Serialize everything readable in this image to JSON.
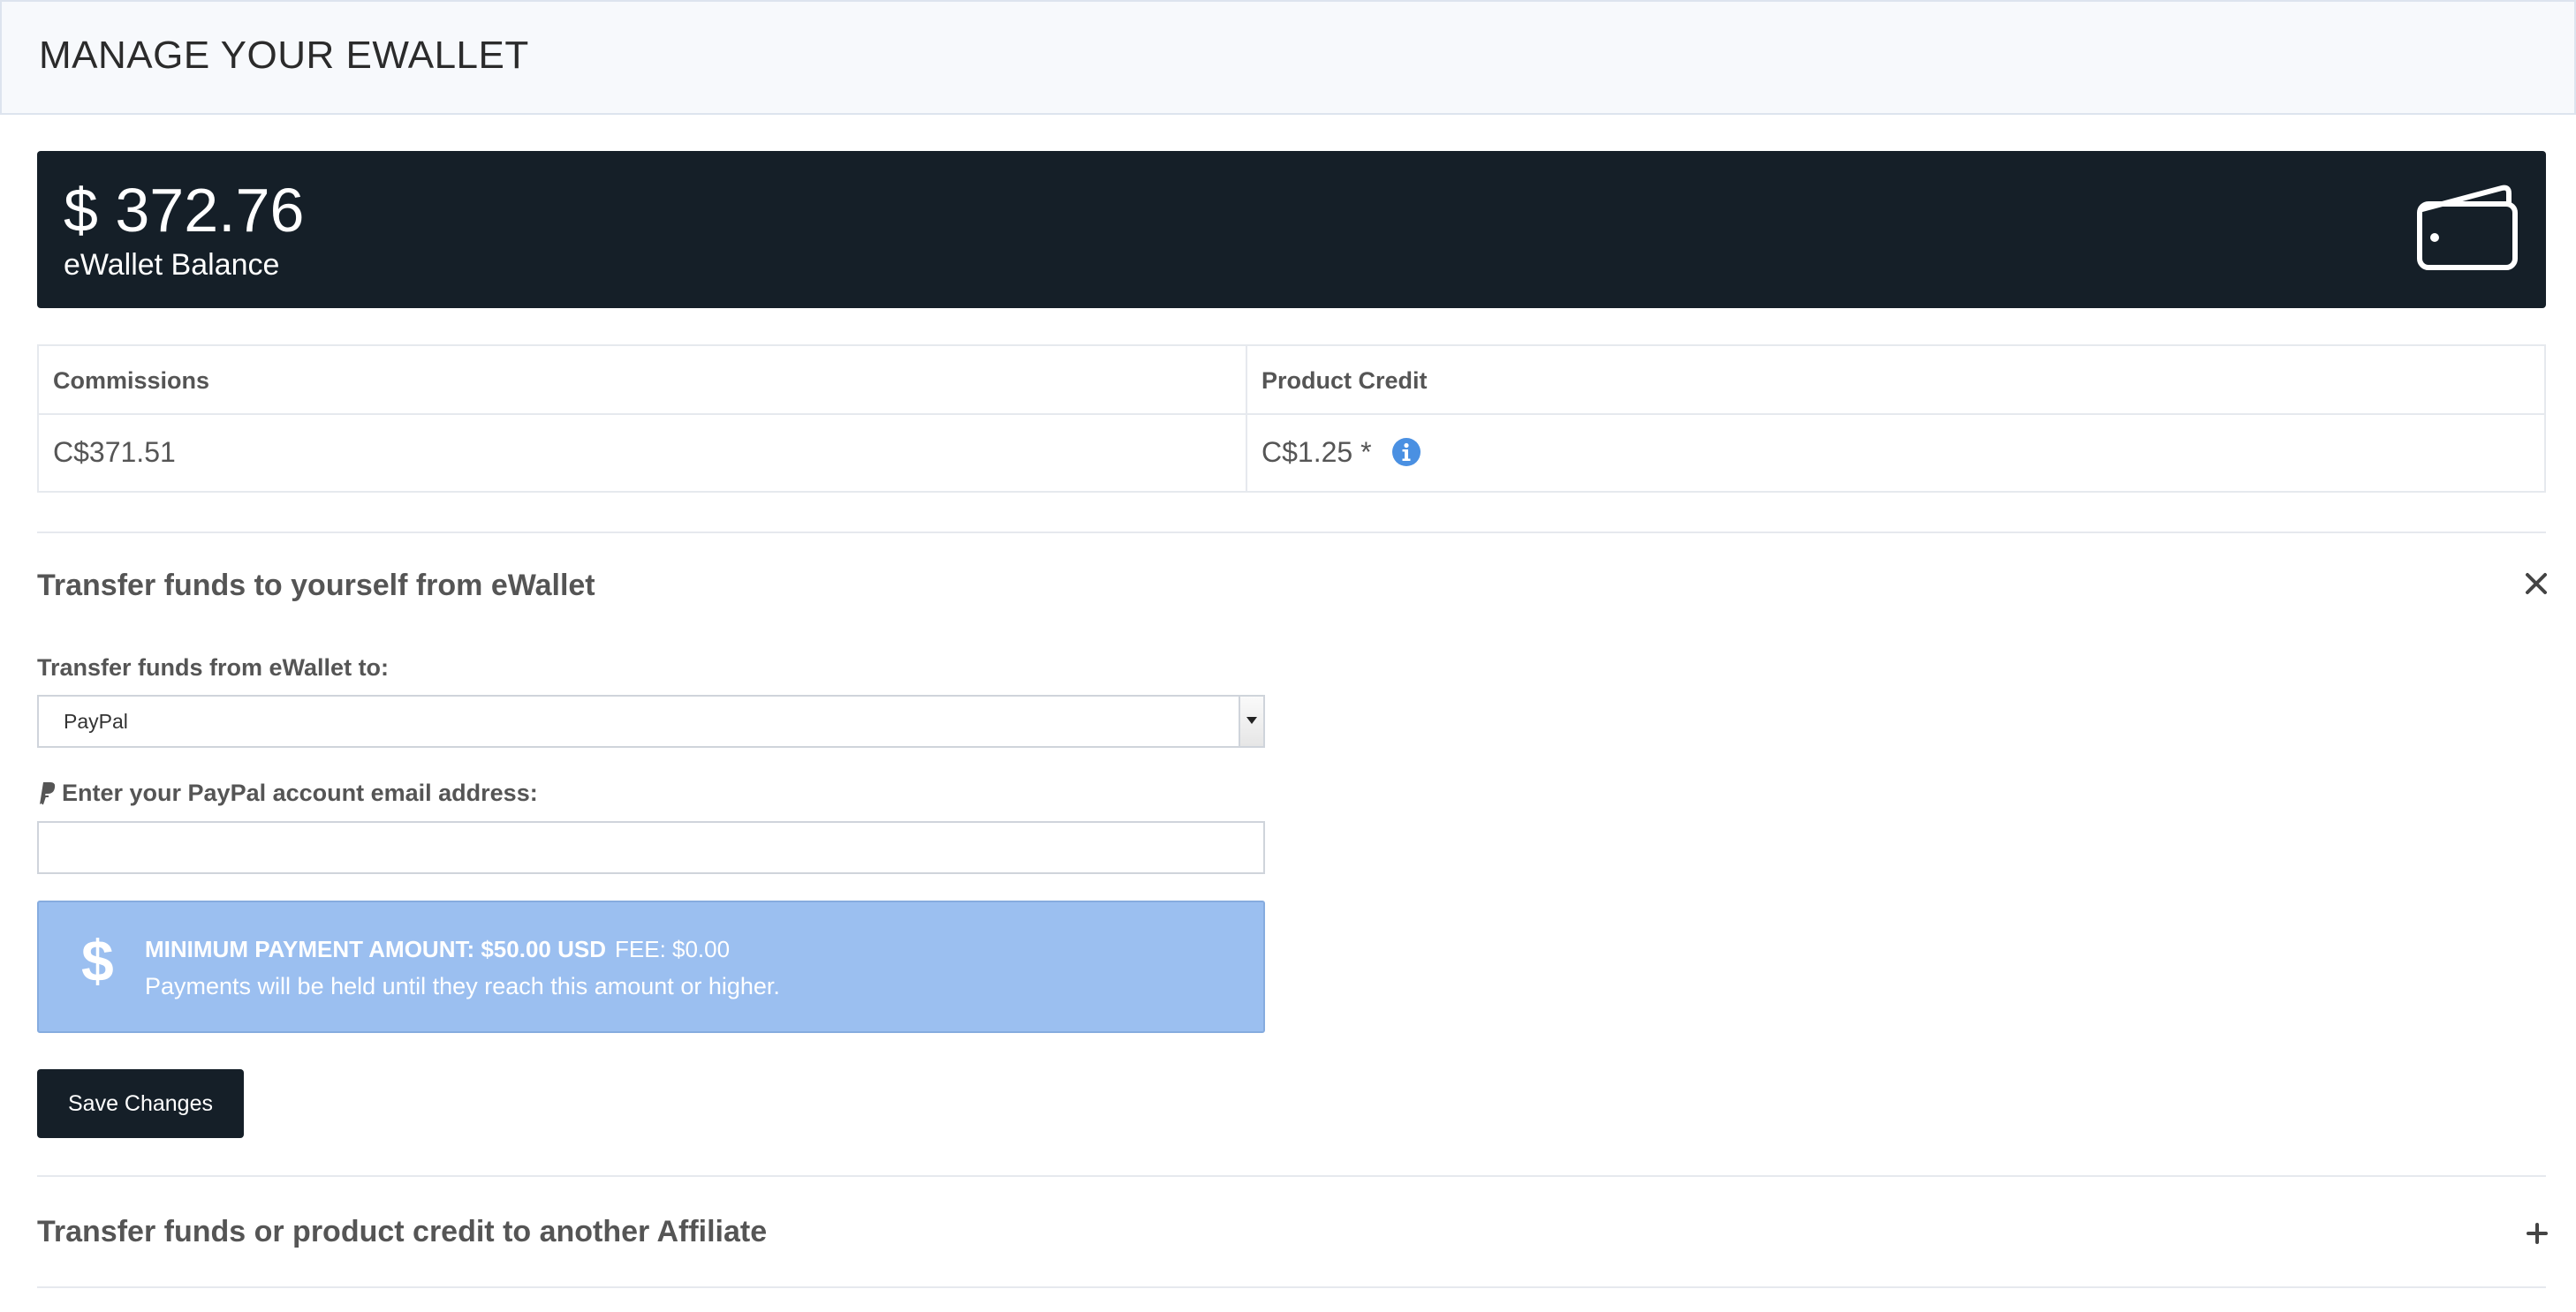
{
  "page": {
    "title": "MANAGE YOUR EWALLET"
  },
  "balance": {
    "amount": "$ 372.76",
    "label": "eWallet Balance",
    "icon": "wallet-icon"
  },
  "credits": {
    "commissions_header": "Commissions",
    "commissions_value": "C$371.51",
    "product_credit_header": "Product Credit",
    "product_credit_value": "C$1.25 *",
    "info_icon": "info-icon"
  },
  "transfer_self": {
    "title": "Transfer funds to yourself from eWallet",
    "close_icon": "close-icon",
    "destination_label": "Transfer funds from eWallet to:",
    "destination_selected": "PayPal",
    "email_label": "Enter your PayPal account email address:",
    "email_value": "",
    "email_placeholder": "",
    "notice": {
      "icon": "dollar-icon",
      "minimum": "MINIMUM PAYMENT AMOUNT: $50.00 USD",
      "fee": "FEE: $0.00",
      "message": "Payments will be held until they reach this amount or higher."
    },
    "save_label": "Save Changes"
  },
  "transfer_affiliate": {
    "title": "Transfer funds or product credit to another Affiliate",
    "expand_icon": "plus-icon"
  },
  "colors": {
    "dark": "#151f28",
    "header_bg": "#f7f9fc",
    "notice_bg": "#9bbff0",
    "info_blue": "#4a90e2"
  }
}
